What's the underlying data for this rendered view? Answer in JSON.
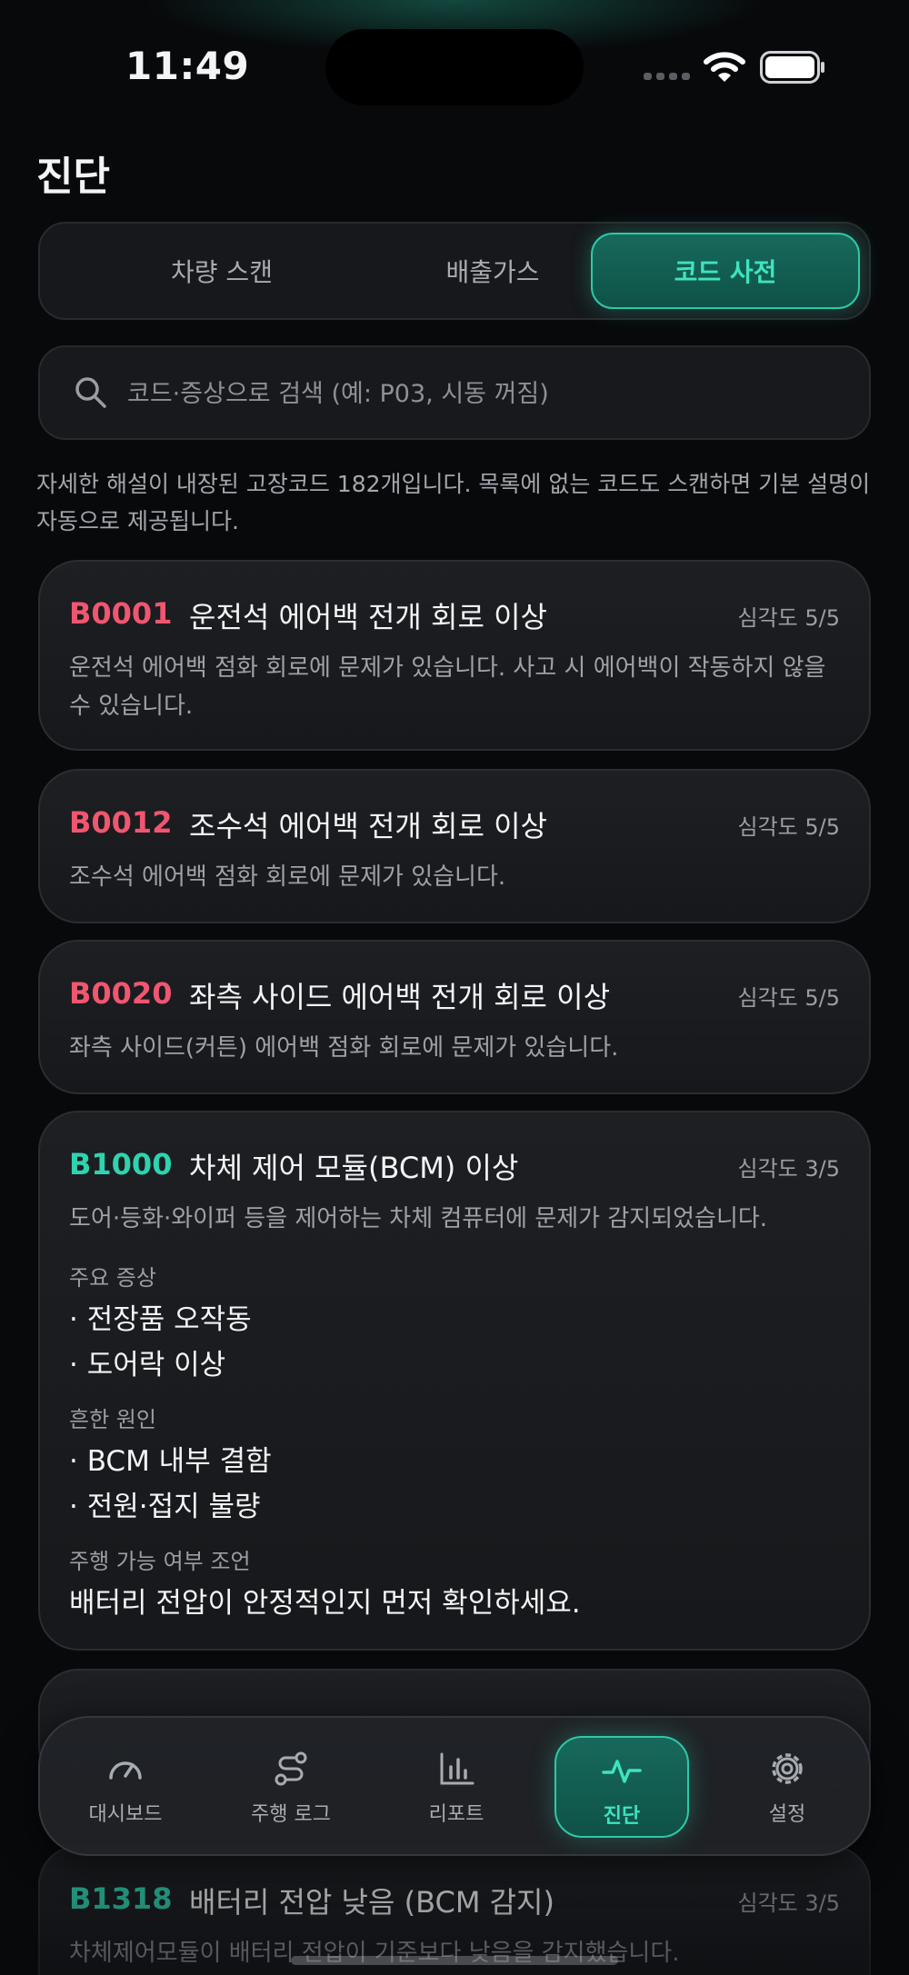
{
  "status_bar": {
    "time": "11:49"
  },
  "page": {
    "title": "진단"
  },
  "segments": [
    {
      "label": "차량 스캔",
      "active": false
    },
    {
      "label": "배출가스",
      "active": false
    },
    {
      "label": "코드 사전",
      "active": true
    }
  ],
  "search": {
    "value": "",
    "placeholder": "코드·증상으로 검색 (예: P03, 시동 꺼짐)"
  },
  "intro": "자세한 해설이 내장된 고장코드 182개입니다. 목록에 없는 코드도 스캔하면 기본 설명이 자동으로 제공됩니다.",
  "codes": [
    {
      "code": "B0001",
      "title": "운전석 에어백 전개 회로 이상",
      "severity": "심각도 5/5",
      "desc": "운전석 에어백 점화 회로에 문제가 있습니다. 사고 시 에어백이 작동하지 않을 수 있습니다."
    },
    {
      "code": "B0012",
      "title": "조수석 에어백 전개 회로 이상",
      "severity": "심각도 5/5",
      "desc": "조수석 에어백 점화 회로에 문제가 있습니다."
    },
    {
      "code": "B0020",
      "title": "좌측 사이드 에어백 전개 회로 이상",
      "severity": "심각도 5/5",
      "desc": "좌측 사이드(커튼) 에어백 점화 회로에 문제가 있습니다."
    },
    {
      "code": "B1000",
      "title": "차체 제어 모듈(BCM) 이상",
      "severity": "심각도 3/5",
      "desc": "도어·등화·와이퍼 등을 제어하는 차체 컴퓨터에 문제가 감지되었습니다.",
      "symptoms_label": "주요 증상",
      "symptoms": [
        "· 전장품 오작동",
        "· 도어락 이상"
      ],
      "causes_label": "흔한 원인",
      "causes": [
        "· BCM 내부 결함",
        "· 전원·접지 불량"
      ],
      "advice_label": "주행 가능 여부 조언",
      "advice": "배터리 전압이 안정적인지 먼저 확인하세요."
    },
    {
      "code": "B1318",
      "title": "배터리 전압 낮음 (BCM 감지)",
      "severity": "심각도 3/5",
      "desc": "차체제어모듈이 배터리 전압이 기준보다 낮음을 감지했습니다."
    }
  ],
  "tabs": [
    {
      "label": "대시보드",
      "icon": "gauge-icon"
    },
    {
      "label": "주행 로그",
      "icon": "route-icon"
    },
    {
      "label": "리포트",
      "icon": "bar-chart-icon"
    },
    {
      "label": "진단",
      "icon": "pulse-icon"
    },
    {
      "label": "설정",
      "icon": "gear-icon"
    }
  ],
  "colors": {
    "accent": "#2fd3b0",
    "critical": "#f0566f",
    "background": "#08090b"
  }
}
